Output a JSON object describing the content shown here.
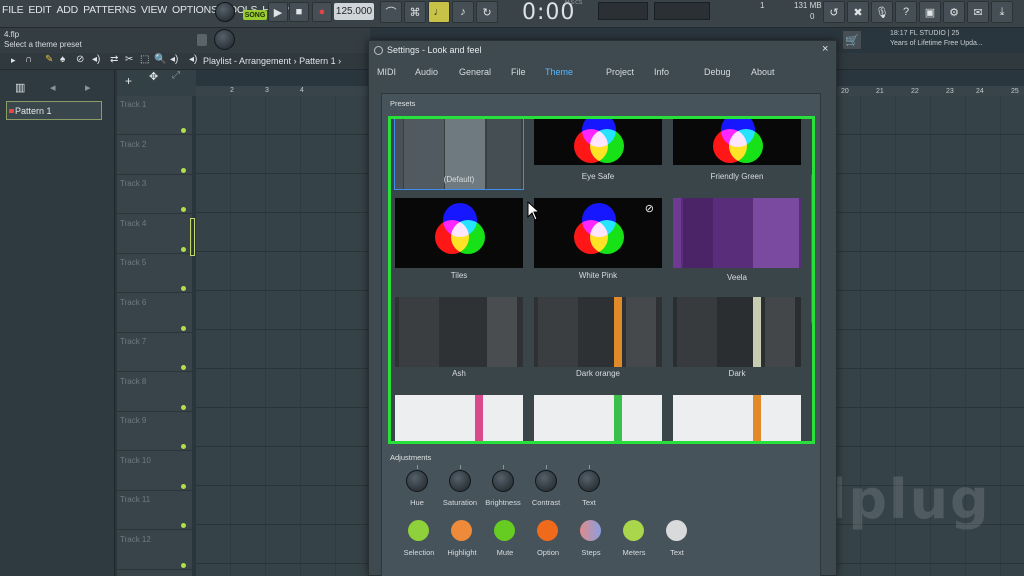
{
  "menu": [
    "FILE",
    "EDIT",
    "ADD",
    "PATTERNS",
    "VIEW",
    "OPTIONS",
    "TOOLS",
    "HELP"
  ],
  "transport": {
    "mode": "SONG",
    "bpm": "125.000",
    "time": "0:00",
    "time_unit": "M:S:CS",
    "cpu": "1",
    "memory": "131 MB",
    "memory_sub": "0"
  },
  "hint": {
    "file": "4.flp",
    "text": "Select a theme preset"
  },
  "news": {
    "line1": "18:17  FL STUDIO | 25",
    "line2": "Years of Lifetime Free Upda..."
  },
  "playlist": {
    "title": "Playlist - Arrangement",
    "pattern": "Pattern 1",
    "ruler": [
      "2",
      "3",
      "4"
    ],
    "ruler_right": [
      "20",
      "21",
      "22",
      "23",
      "24",
      "25"
    ]
  },
  "patterns": [
    "Pattern 1"
  ],
  "tracks": [
    "Track 1",
    "Track 2",
    "Track 3",
    "Track 4",
    "Track 5",
    "Track 6",
    "Track 7",
    "Track 8",
    "Track 9",
    "Track 10",
    "Track 11",
    "Track 12"
  ],
  "dialog": {
    "title": "Settings - Look and feel",
    "tabs": [
      "MIDI",
      "Audio",
      "General",
      "File",
      "Theme",
      "Project",
      "Info",
      "Debug",
      "About"
    ],
    "active_tab": "Theme",
    "presets_label": "Presets",
    "presets": [
      "(Default)",
      "Eye Safe",
      "Friendly Green",
      "Tiles",
      "White Pink",
      "Veela",
      "Ash",
      "Dark orange",
      "Dark",
      "",
      "",
      ""
    ],
    "selected_preset": "(Default)",
    "adjustments_label": "Adjustments",
    "knobs": [
      "Hue",
      "Saturation",
      "Brightness",
      "Contrast",
      "Text"
    ],
    "colors": [
      {
        "label": "Selection",
        "color": "#8fd13a"
      },
      {
        "label": "Highlight",
        "color": "#ee8a3a"
      },
      {
        "label": "Mute",
        "color": "#66cc22"
      },
      {
        "label": "Option",
        "color": "#f06a1c"
      },
      {
        "label": "Steps",
        "color": "#9aa0c8"
      },
      {
        "label": "Meters",
        "color": "#a9d64a"
      },
      {
        "label": "Text",
        "color": "#d8dadb"
      }
    ]
  },
  "watermark": "oddplug",
  "accent": "#27e03a"
}
